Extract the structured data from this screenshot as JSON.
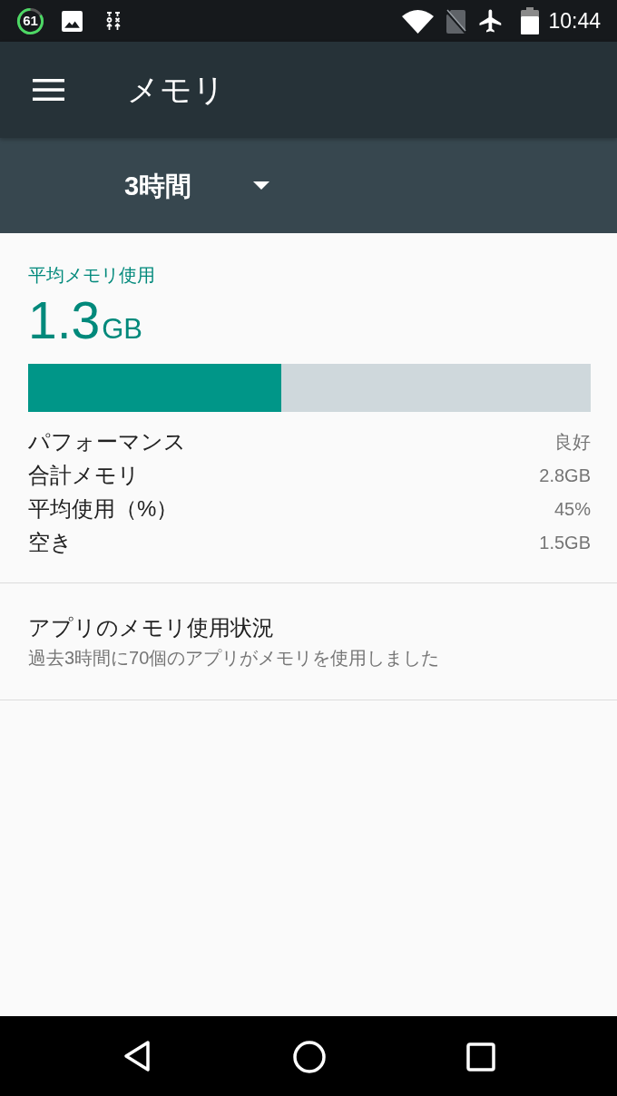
{
  "status_bar": {
    "notification_count": "61",
    "time": "10:44"
  },
  "app_bar": {
    "title": "メモリ"
  },
  "period_spinner": {
    "value": "3時間"
  },
  "summary": {
    "label": "平均メモリ使用",
    "value": "1.3",
    "unit": "GB",
    "level": 0.45,
    "stats": [
      {
        "label": "パフォーマンス",
        "value": "良好"
      },
      {
        "label": "合計メモリ",
        "value": "2.8GB"
      },
      {
        "label": "平均使用（%）",
        "value": "45%"
      },
      {
        "label": "空き",
        "value": "1.5GB"
      }
    ]
  },
  "app_usage": {
    "title": "アプリのメモリ使用状況",
    "subtitle": "過去3時間に70個のアプリがメモリを使用しました"
  }
}
